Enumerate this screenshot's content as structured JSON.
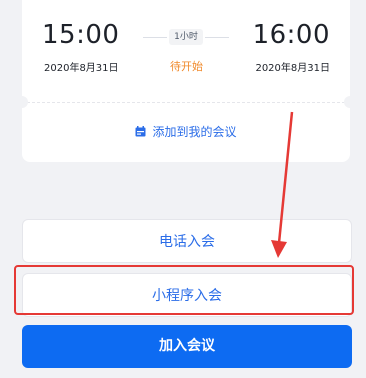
{
  "meeting": {
    "start_time": "15:00",
    "start_date": "2020年8月31日",
    "end_time": "16:00",
    "end_date": "2020年8月31日",
    "duration": "1小时",
    "status": "待开始",
    "add_calendar_label": "添加到我的会议"
  },
  "actions": {
    "phone_join": "电话入会",
    "miniprogram_join": "小程序入会",
    "join_meeting": "加入会议"
  },
  "colors": {
    "accent": "#0d6bf2",
    "status": "#f08a2c",
    "annotation": "#e53935"
  },
  "icons": {
    "calendar": "calendar-icon",
    "annotation_arrow": "red-arrow-annotation"
  }
}
